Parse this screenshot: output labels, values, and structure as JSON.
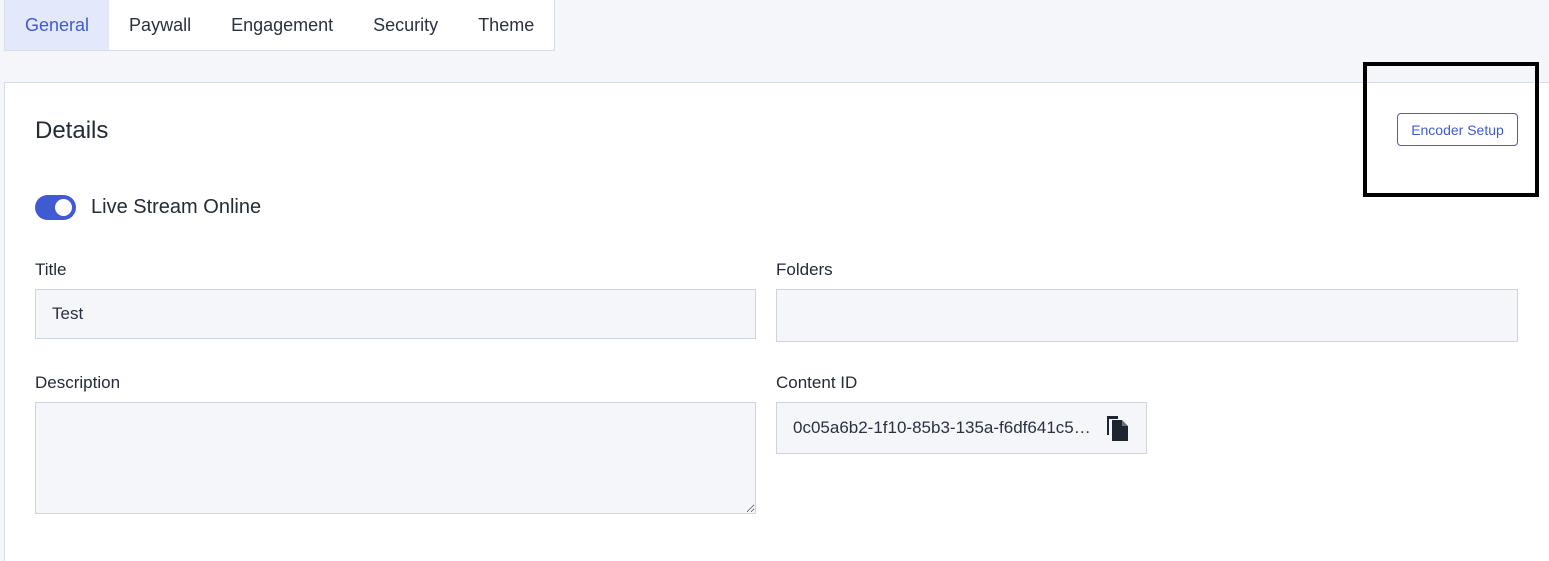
{
  "tabs": [
    {
      "label": "General",
      "active": true
    },
    {
      "label": "Paywall",
      "active": false
    },
    {
      "label": "Engagement",
      "active": false
    },
    {
      "label": "Security",
      "active": false
    },
    {
      "label": "Theme",
      "active": false
    }
  ],
  "details": {
    "title": "Details",
    "encoder_button": "Encoder Setup"
  },
  "live_toggle": {
    "label": "Live Stream Online",
    "on": true
  },
  "fields": {
    "title": {
      "label": "Title",
      "value": "Test"
    },
    "folders": {
      "label": "Folders",
      "value": ""
    },
    "description": {
      "label": "Description",
      "value": ""
    },
    "content_id": {
      "label": "Content ID",
      "value": "0c05a6b2-1f10-85b3-135a-f6df641c5…",
      "icon": "copy-icon"
    }
  },
  "colors": {
    "accent": "#3f5bd4",
    "active_tab_bg": "#e3e8fb",
    "field_bg": "#f4f6fa"
  }
}
